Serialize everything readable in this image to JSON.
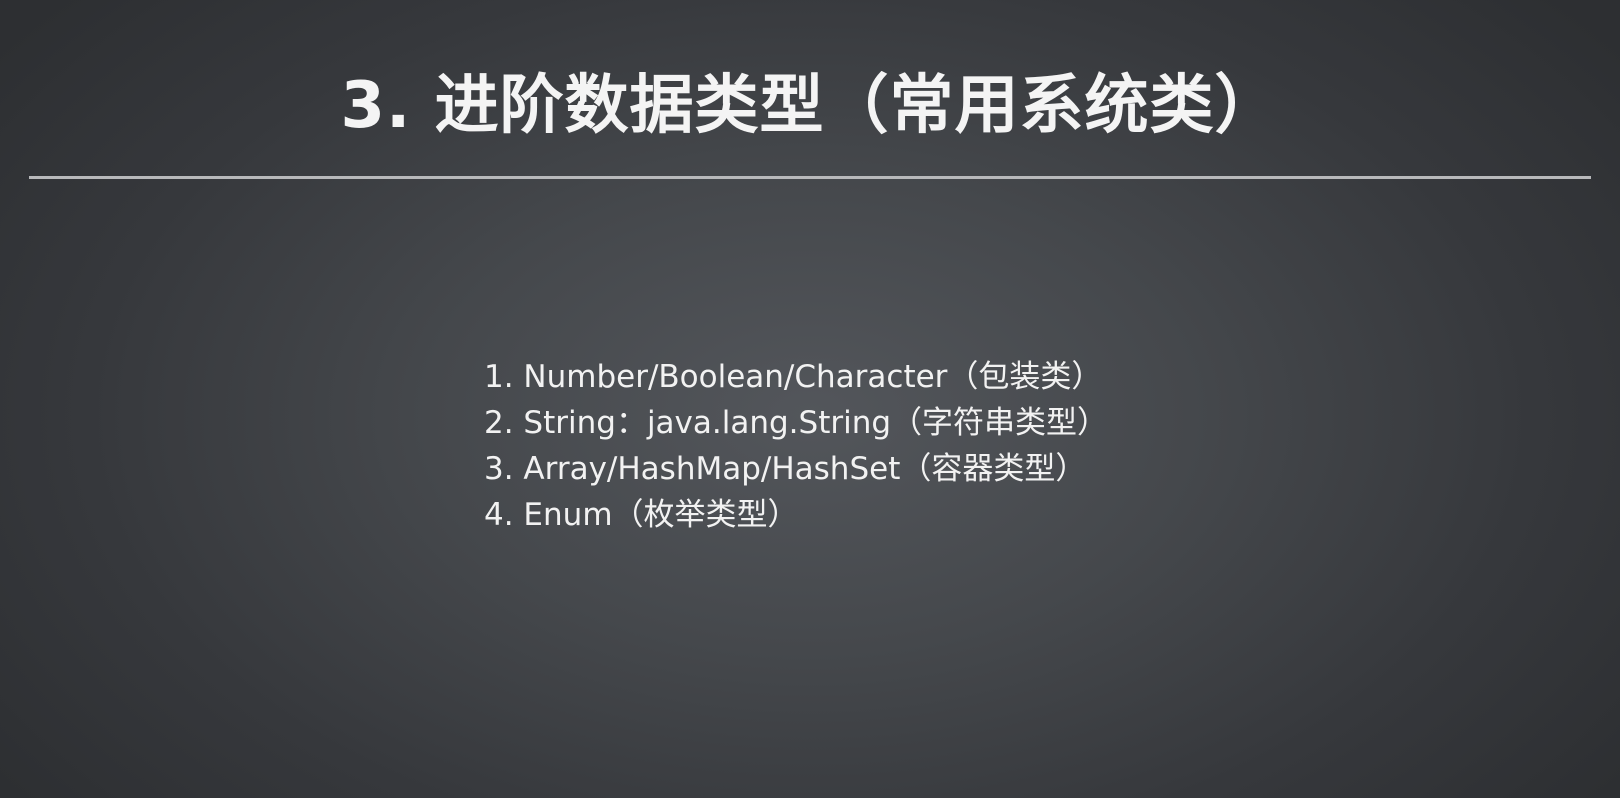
{
  "slide": {
    "title": "3. 进阶数据类型（常用系统类）",
    "items": [
      "1. Number/Boolean/Character（包装类）",
      "2. String：java.lang.String（字符串类型）",
      "3. Array/HashMap/HashSet（容器类型）",
      "4. Enum（枚举类型）"
    ]
  },
  "colors": {
    "background_center": "#53565b",
    "background_edge": "#2d2f32",
    "text": "#f4f4f4",
    "divider": "#b8b9bb"
  }
}
